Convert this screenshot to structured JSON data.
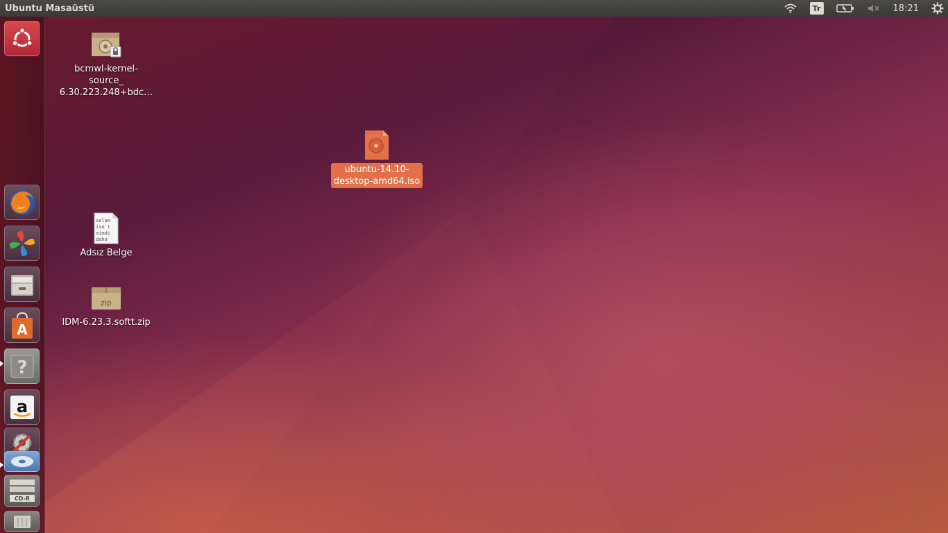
{
  "topbar": {
    "title": "Ubuntu Masaüstü",
    "keyboard_layout": "Tr",
    "clock": "18:21",
    "icons": [
      "wifi-icon",
      "keyboard-layout-icon",
      "battery-icon",
      "volume-muted-icon",
      "session-gear-icon"
    ]
  },
  "launcher": {
    "items": [
      {
        "name": "ubuntu-dash",
        "icon": "ubuntu-logo-icon"
      },
      {
        "name": "firefox",
        "icon": "firefox-icon"
      },
      {
        "name": "libreoffice-like",
        "icon": "clover-app-icon"
      },
      {
        "name": "files",
        "icon": "file-cabinet-icon"
      },
      {
        "name": "software-center",
        "icon": "shopping-bag-icon"
      },
      {
        "name": "help",
        "icon": "help-question-icon"
      },
      {
        "name": "amazon",
        "icon": "amazon-icon"
      },
      {
        "name": "settings",
        "icon": "system-settings-icon"
      },
      {
        "name": "disk-drive",
        "icon": "disc-drive-icon"
      },
      {
        "name": "cd-r",
        "icon": "cd-r-icon",
        "label": "CD-R"
      },
      {
        "name": "trash",
        "icon": "trash-icon"
      }
    ]
  },
  "desktop": {
    "icons": [
      {
        "label_lines": [
          "bcmwl-kernel-",
          "source_",
          "6.30.223.248+bdc…"
        ],
        "icon": "deb-package-locked-icon"
      },
      {
        "label_lines": [
          "ubuntu-14.10-",
          "desktop-amd64.iso"
        ],
        "icon": "disc-image-icon",
        "selected": true
      },
      {
        "label_lines": [
          "Adsız Belge"
        ],
        "icon": "text-document-icon",
        "preview_text": [
          "selam",
          "iso t",
          "aimdi",
          "daha"
        ]
      },
      {
        "label_lines": [
          "IDM-6.23.3.softt.zip"
        ],
        "icon": "zip-archive-icon",
        "badge": "zip"
      }
    ]
  },
  "colors": {
    "selection": "#e2714a",
    "panel": "#3b3a36",
    "panel_text": "#dfdbd2"
  }
}
